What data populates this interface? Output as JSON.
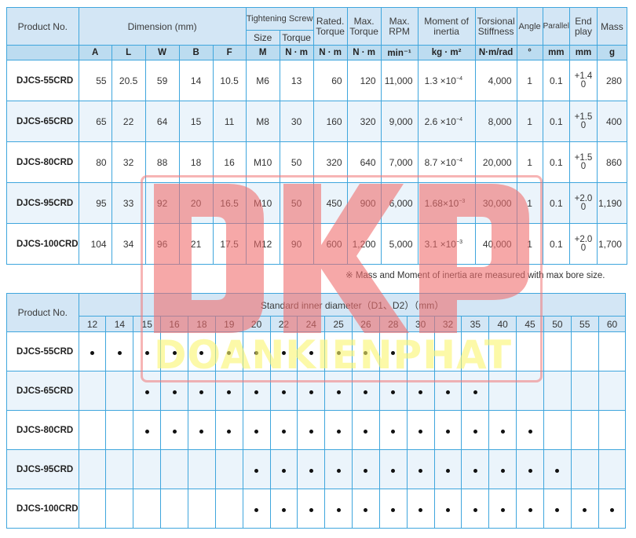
{
  "spec_table": {
    "headers": {
      "product_no": "Product No.",
      "dimension": "Dimension (mm)",
      "tightening_screw": "Tightening Screw",
      "size": "Size",
      "torque": "Torque",
      "rated_torque": "Rated. Torque",
      "max_torque": "Max. Torque",
      "max_rpm": "Max. RPM",
      "moment_of_inertia": "Moment of inertia",
      "torsional_stiffness": "Torsional Stiffness",
      "angle": "Angle",
      "parallel": "Parallel",
      "end_play": "End play",
      "mass": "Mass"
    },
    "units": [
      "A",
      "L",
      "W",
      "B",
      "F",
      "M",
      "N · m",
      "N · m",
      "N · m",
      "min⁻¹",
      "kg · m²",
      "N·m/rad",
      "°",
      "mm",
      "mm",
      "g"
    ],
    "rows": [
      {
        "product": "DJCS-55CRD",
        "A": "55",
        "L": "20.5",
        "W": "59",
        "B": "14",
        "F": "10.5",
        "M": "M6",
        "screw_torque": "13",
        "rated_torque": "60",
        "max_torque": "120",
        "max_rpm": "11,000",
        "inertia_mantissa": "1.3 ×10",
        "inertia_exp": "−4",
        "stiffness": "4,000",
        "angle": "1",
        "parallel": "0.1",
        "end_play_plus": "+1.4",
        "end_play_minus": "0",
        "mass": "280"
      },
      {
        "product": "DJCS-65CRD",
        "A": "65",
        "L": "22",
        "W": "64",
        "B": "15",
        "F": "11",
        "M": "M8",
        "screw_torque": "30",
        "rated_torque": "160",
        "max_torque": "320",
        "max_rpm": "9,000",
        "inertia_mantissa": "2.6 ×10",
        "inertia_exp": "−4",
        "stiffness": "8,000",
        "angle": "1",
        "parallel": "0.1",
        "end_play_plus": "+1.5",
        "end_play_minus": "0",
        "mass": "400"
      },
      {
        "product": "DJCS-80CRD",
        "A": "80",
        "L": "32",
        "W": "88",
        "B": "18",
        "F": "16",
        "M": "M10",
        "screw_torque": "50",
        "rated_torque": "320",
        "max_torque": "640",
        "max_rpm": "7,000",
        "inertia_mantissa": "8.7 ×10",
        "inertia_exp": "−4",
        "stiffness": "20,000",
        "angle": "1",
        "parallel": "0.1",
        "end_play_plus": "+1.5",
        "end_play_minus": "0",
        "mass": "860"
      },
      {
        "product": "DJCS-95CRD",
        "A": "95",
        "L": "33",
        "W": "92",
        "B": "20",
        "F": "16.5",
        "M": "M10",
        "screw_torque": "50",
        "rated_torque": "450",
        "max_torque": "900",
        "max_rpm": "6,000",
        "inertia_mantissa": "1.68×10",
        "inertia_exp": "−3",
        "stiffness": "30,000",
        "angle": "1",
        "parallel": "0.1",
        "end_play_plus": "+2.0",
        "end_play_minus": "0",
        "mass": "1,190"
      },
      {
        "product": "DJCS-100CRD",
        "A": "104",
        "L": "34",
        "W": "96",
        "B": "21",
        "F": "17.5",
        "M": "M12",
        "screw_torque": "90",
        "rated_torque": "600",
        "max_torque": "1,200",
        "max_rpm": "5,000",
        "inertia_mantissa": "3.1 ×10",
        "inertia_exp": "−3",
        "stiffness": "40,000",
        "angle": "1",
        "parallel": "0.1",
        "end_play_plus": "+2.0",
        "end_play_minus": "0",
        "mass": "1,700"
      }
    ],
    "note": "※ Mass and Moment of inertia are measured with max bore size."
  },
  "bore_table": {
    "headers": {
      "product_no": "Product No.",
      "title": "Standard inner diameter（D1、D2）（mm）"
    },
    "diameters": [
      "12",
      "14",
      "15",
      "16",
      "18",
      "19",
      "20",
      "22",
      "24",
      "25",
      "26",
      "28",
      "30",
      "32",
      "35",
      "40",
      "45",
      "50",
      "55",
      "60"
    ],
    "rows": [
      {
        "product": "DJCS-55CRD",
        "available": [
          "12",
          "14",
          "15",
          "16",
          "18",
          "19",
          "20",
          "22",
          "24",
          "25",
          "26",
          "28"
        ]
      },
      {
        "product": "DJCS-65CRD",
        "available": [
          "15",
          "16",
          "18",
          "19",
          "20",
          "22",
          "24",
          "25",
          "26",
          "28",
          "30",
          "32",
          "35"
        ]
      },
      {
        "product": "DJCS-80CRD",
        "available": [
          "15",
          "16",
          "18",
          "19",
          "20",
          "22",
          "24",
          "25",
          "26",
          "28",
          "30",
          "32",
          "35",
          "40",
          "45"
        ]
      },
      {
        "product": "DJCS-95CRD",
        "available": [
          "20",
          "22",
          "24",
          "25",
          "26",
          "28",
          "30",
          "32",
          "35",
          "40",
          "45",
          "50"
        ]
      },
      {
        "product": "DJCS-100CRD",
        "available": [
          "20",
          "22",
          "24",
          "25",
          "26",
          "28",
          "30",
          "32",
          "35",
          "40",
          "45",
          "50",
          "55",
          "60"
        ]
      }
    ]
  },
  "watermark": {
    "letters": "DKP",
    "text": "DOANKIENPHAT",
    "letters_color": "#f07a7a",
    "text_color": "#f8f06a"
  }
}
